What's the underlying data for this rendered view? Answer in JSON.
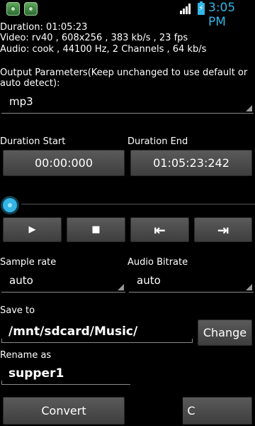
{
  "status": {
    "time": "3:05 PM"
  },
  "info": {
    "duration": "Duration: 01:05:23",
    "video": "Video: rv40 , 608x256 , 383 kb/s , 23 fps",
    "audio": "Audio: cook , 44100 Hz, 2 Channels , 64 kb/s"
  },
  "output": {
    "label_line1": "Output Parameters(Keep unchanged to use default or",
    "label_line2": "auto detect):",
    "format": "mp3"
  },
  "duration_start": {
    "label": "Duration Start",
    "value": "00:00:000"
  },
  "duration_end": {
    "label": "Duration End",
    "value": "01:05:23:242"
  },
  "player": {
    "play_icon": "▶",
    "stop_icon": "■",
    "prev_icon": "⇤",
    "next_icon": "⇥",
    "seek_position": 0
  },
  "sample_rate": {
    "label": "Sample rate",
    "value": "auto"
  },
  "audio_bitrate": {
    "label": "Audio Bitrate",
    "value": "auto"
  },
  "save_to": {
    "label": "Save to",
    "path": "/mnt/sdcard/Music/",
    "change_label": "Change"
  },
  "rename": {
    "label": "Rename as",
    "value": "supper1"
  },
  "actions": {
    "convert_label": "Convert",
    "second_label": "C"
  },
  "colors": {
    "accent": "#33b5e5",
    "background": "#000000",
    "button": "#4a4a4a"
  }
}
